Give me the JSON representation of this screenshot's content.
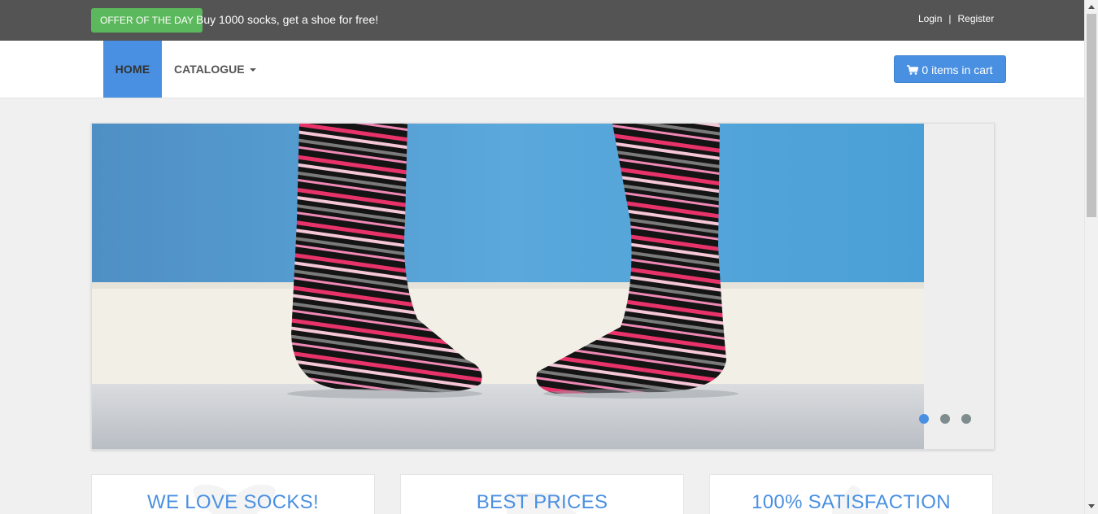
{
  "topbar": {
    "offer_badge": "OFFER OF THE DAY",
    "offer_text": "Buy 1000 socks, get a shoe for free!",
    "login_label": "Login",
    "separator": "|",
    "register_label": "Register"
  },
  "nav": {
    "home_label": "HOME",
    "catalogue_label": "CATALOGUE",
    "cart_label": "0 items in cart"
  },
  "carousel": {
    "slides": 3,
    "active_slide": 1
  },
  "features": [
    {
      "title": "WE LOVE SOCKS!"
    },
    {
      "title": "BEST PRICES"
    },
    {
      "title": "100% SATISFACTION"
    }
  ],
  "icons": {
    "cart": "shopping-cart-icon",
    "caret": "chevron-down-icon"
  },
  "colors": {
    "topbar_bg": "#545454",
    "accent": "#4a90e2",
    "offer_green": "#5cb85c",
    "page_bg": "#f0f0f0"
  }
}
